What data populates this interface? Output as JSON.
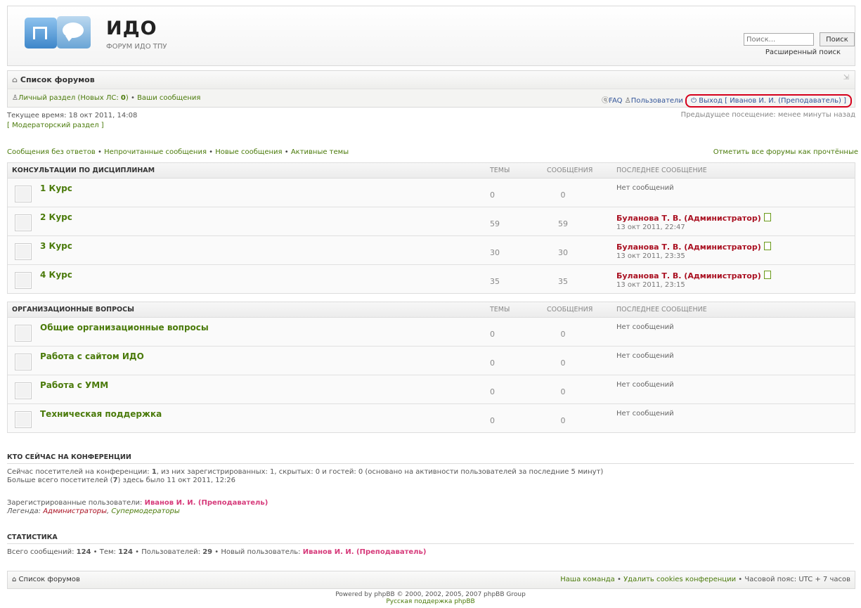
{
  "header": {
    "title": "ИДО",
    "subtitle": "ФОРУМ ИДО ТПУ"
  },
  "search": {
    "placeholder": "Поиск...",
    "button": "Поиск",
    "advanced": "Расширенный поиск"
  },
  "nav": {
    "home": "Список форумов",
    "ucp_label": "Личный раздел (Новых ЛС: ",
    "ucp_count": "0",
    "ucp_close": ")",
    "sep": " • ",
    "my_posts": "Ваши сообщения",
    "faq": "FAQ",
    "members": "Пользователи",
    "logout": "Выход [ Иванов И. И. (Преподаватель) ]"
  },
  "time": {
    "current": "Текущее время: 18 окт 2011, 14:08",
    "mcp": "[ Модераторский раздел ]",
    "last_visit": "Предыдущее посещение: менее минуты назад"
  },
  "quick": {
    "unanswered": "Сообщения без ответов",
    "unread": "Непрочитанные сообщения",
    "new": "Новые сообщения",
    "active": "Активные темы",
    "mark_read": "Отметить все форумы как прочтённые"
  },
  "columns": {
    "topics": "ТЕМЫ",
    "posts": "СООБЩЕНИЯ",
    "last": "ПОСЛЕДНЕЕ СООБЩЕНИЕ"
  },
  "categories": [
    {
      "name": "КОНСУЛЬТАЦИИ ПО ДИСЦИПЛИНАМ",
      "forums": [
        {
          "name": "1 Курс",
          "topics": "0",
          "posts": "0",
          "last_author": "",
          "last_date": "",
          "no_posts": "Нет сообщений"
        },
        {
          "name": "2 Курс",
          "topics": "59",
          "posts": "59",
          "last_author": "Буланова Т. В. (Администратор)",
          "last_date": "13 окт 2011, 22:47",
          "no_posts": ""
        },
        {
          "name": "3 Курс",
          "topics": "30",
          "posts": "30",
          "last_author": "Буланова Т. В. (Администратор)",
          "last_date": "13 окт 2011, 23:35",
          "no_posts": ""
        },
        {
          "name": "4 Курс",
          "topics": "35",
          "posts": "35",
          "last_author": "Буланова Т. В. (Администратор)",
          "last_date": "13 окт 2011, 23:15",
          "no_posts": ""
        }
      ]
    },
    {
      "name": "ОРГАНИЗАЦИОННЫЕ ВОПРОСЫ",
      "forums": [
        {
          "name": "Общие организационные вопросы",
          "topics": "0",
          "posts": "0",
          "last_author": "",
          "last_date": "",
          "no_posts": "Нет сообщений"
        },
        {
          "name": "Работа с сайтом ИДО",
          "topics": "0",
          "posts": "0",
          "last_author": "",
          "last_date": "",
          "no_posts": "Нет сообщений"
        },
        {
          "name": "Работа с УММ",
          "topics": "0",
          "posts": "0",
          "last_author": "",
          "last_date": "",
          "no_posts": "Нет сообщений"
        },
        {
          "name": "Техническая поддержка",
          "topics": "0",
          "posts": "0",
          "last_author": "",
          "last_date": "",
          "no_posts": "Нет сообщений"
        }
      ]
    }
  ],
  "online": {
    "title": "КТО СЕЙЧАС НА КОНФЕРЕНЦИИ",
    "line1_a": "Сейчас посетителей на конференции: ",
    "line1_b": "1",
    "line1_c": ", из них зарегистрированных: 1, скрытых: 0 и гостей: 0 (основано на активности пользователей за последние 5 минут)",
    "line2_a": "Больше всего посетителей (",
    "line2_b": "7",
    "line2_c": ") здесь было 11 окт 2011, 12:26",
    "registered_label": "Зарегистрированные пользователи: ",
    "registered_user": "Иванов И. И. (Преподаватель)",
    "legend_label": "Легенда: ",
    "legend_admins": "Администраторы",
    "legend_sep": ", ",
    "legend_smods": "Супермодераторы"
  },
  "stats": {
    "title": "СТАТИСТИКА",
    "posts_label": "Всего сообщений: ",
    "posts": "124",
    "topics_label": " • Тем: ",
    "topics": "124",
    "users_label": " • Пользователей: ",
    "users": "29",
    "newest_label": " • Новый пользователь: ",
    "newest": "Иванов И. И. (Преподаватель)"
  },
  "footer": {
    "home": "Список форумов",
    "team": "Наша команда",
    "sep": " • ",
    "delete_cookies": "Удалить cookies конференции",
    "timezone": "Часовой пояс: UTC + 7 часов"
  },
  "powered": {
    "line1": "Powered by phpBB © 2000, 2002, 2005, 2007 phpBB Group",
    "line2": "Русская поддержка phpBB"
  }
}
